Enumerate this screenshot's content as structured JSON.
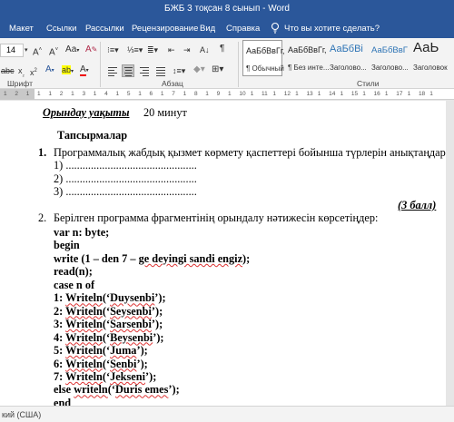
{
  "window": {
    "title": "БЖБ 3 тоқсан 8 сынып  -  Word"
  },
  "tabs": [
    {
      "label": "Макет"
    },
    {
      "label": "Ссылки"
    },
    {
      "label": "Рассылки"
    },
    {
      "label": "Рецензирование"
    },
    {
      "label": "Вид"
    },
    {
      "label": "Справка"
    }
  ],
  "tell_me": {
    "placeholder": "Что вы хотите сделать?"
  },
  "ribbon": {
    "font_size": "14",
    "group_font": "Шрифт",
    "group_paragraph": "Абзац",
    "group_styles": "Стили",
    "styles": [
      {
        "sample": "АаБбВвГг,",
        "name": "¶ Обычный",
        "selected": true
      },
      {
        "sample": "АаБбВвГг,",
        "name": "¶ Без инте...",
        "selected": false
      },
      {
        "sample": "АаБбВі",
        "name": "Заголово...",
        "selected": false
      },
      {
        "sample": "АаБбВвГ",
        "name": "Заголово...",
        "selected": false
      },
      {
        "sample": "АаЬ",
        "name": "Заголовок",
        "selected": false
      }
    ]
  },
  "ruler": {
    "ticks": [
      "1",
      "2",
      "1",
      "1",
      "1",
      "2",
      "1",
      "3",
      "1",
      "4",
      "1",
      "5",
      "1",
      "6",
      "1",
      "7",
      "1",
      "8",
      "1",
      "9",
      "1",
      "10",
      "1",
      "11",
      "1",
      "12",
      "1",
      "13",
      "1",
      "14",
      "1",
      "15",
      "1",
      "16",
      "1",
      "17",
      "1",
      "18",
      "1"
    ]
  },
  "document": {
    "time_label": "Орындау уақыты",
    "time_value": "20 минут",
    "tasks_heading": "Тапсырмалар",
    "q1": {
      "num": "1.",
      "text": "Программалық жабдық қызмет көрмету қаспеттері бойынша түрлерін анықтаңдар:",
      "blanks": [
        "1)  ...............................................",
        "2)  ...............................................",
        "3)  ..............................................."
      ],
      "score": "(3  балл)"
    },
    "q2": {
      "num": "2.",
      "text": "Берілген программа фрагментінің орындалу нәтижесін көрсетіңдер:",
      "code": [
        {
          "plain": "var n: byte;",
          "squiggle": ""
        },
        {
          "plain": "begin",
          "squiggle": ""
        },
        {
          "plain": "write (1 – den 7 – ",
          "squiggle": "ge deyingi sandi engiz",
          "tail": ");"
        },
        {
          "plain": "read(n);",
          "squiggle": ""
        },
        {
          "plain": "case n of",
          "squiggle": ""
        },
        {
          "plain": "1: ",
          "squiggle": "Writeln",
          "tail": "(‘",
          "sq2": "Duysenbi",
          "tail2": "’);"
        },
        {
          "plain": "2: ",
          "squiggle": "Writeln",
          "tail": "(‘",
          "sq2": "Seysenbi",
          "tail2": "’);"
        },
        {
          "plain": "3: ",
          "squiggle": "Writeln",
          "tail": "(‘",
          "sq2": "Sarsenbi",
          "tail2": "’);"
        },
        {
          "plain": "4: ",
          "squiggle": "Writeln",
          "tail": "(‘",
          "sq2": "Beysenbi",
          "tail2": "’);"
        },
        {
          "plain": "5: ",
          "squiggle": "Writeln",
          "tail": "(‘",
          "sq2": "Juma",
          "tail2": "’);"
        },
        {
          "plain": "6: ",
          "squiggle": "Writeln",
          "tail": "(‘",
          "sq2": "Senbi",
          "tail2": "’);"
        },
        {
          "plain": "7: ",
          "squiggle": "Writeln",
          "tail": "(‘",
          "sq2": "Jekseni",
          "tail2": "’);"
        },
        {
          "plain": "else ",
          "squiggle": "writeln",
          "tail": "(‘",
          "sq2": "Duris emes",
          "tail2": "’);"
        },
        {
          "plain": "end",
          "squiggle": ""
        }
      ]
    }
  },
  "status": {
    "language": "кий (США)"
  },
  "colors": {
    "titlebar": "#2b579a",
    "ribbon": "#f3f3f3",
    "squiggle": "#dd3333"
  }
}
